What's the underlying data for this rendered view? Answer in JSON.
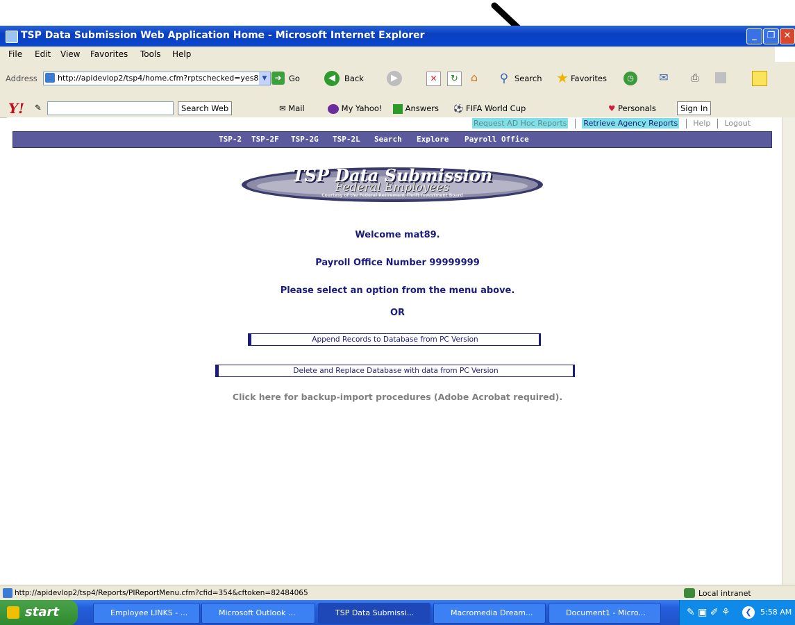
{
  "window": {
    "title": "TSP Data Submission Web Application Home - Microsoft Internet Explorer"
  },
  "menubar": {
    "items": [
      "File",
      "Edit",
      "View",
      "Favorites",
      "Tools",
      "Help"
    ]
  },
  "addressbar": {
    "label": "Address",
    "url": "http://apidevlop2/tsp4/home.cfm?rptschecked=yes8",
    "go": "Go",
    "back": "Back",
    "search": "Search",
    "favorites": "Favorites"
  },
  "yahoo_toolbar": {
    "search_web": "Search Web",
    "mail": "Mail",
    "my_yahoo": "My Yahoo!",
    "answers": "Answers",
    "fifa": "FIFA World Cup",
    "personals": "Personals",
    "sign_in": "Sign In"
  },
  "top_nav": {
    "request_adhoc": "Request AD Hoc Reports",
    "retrieve_agency": "Retrieve Agency Reports",
    "help": "Help",
    "logout": "Logout"
  },
  "main_nav": [
    "TSP-2",
    "TSP-2F",
    "TSP-2G",
    "TSP-2L",
    "Search",
    "Explore",
    "Payroll Office"
  ],
  "logo": {
    "line1": "TSP Data Submission",
    "line2": "Federal Employees",
    "line3": "Courtesy of the Federal Retirement Thrift Investment Board"
  },
  "main": {
    "welcome": "Welcome mat89.",
    "payroll": "Payroll Office Number 99999999",
    "instruction": "Please select an option from the menu above.",
    "or": "OR",
    "append_button": "Append Records to Database from PC Version",
    "replace_button": "Delete and Replace Database with data from PC Version",
    "backup_link": "Click here for backup-import procedures (Adobe Acrobat required)."
  },
  "statusbar": {
    "url": "http://apidevlop2/tsp4/Reports/PIReportMenu.cfm?cfid=354&cftoken=82484065",
    "zone": "Local intranet"
  },
  "taskbar": {
    "start": "start",
    "tasks": [
      "Employee LINKS - ...",
      "Microsoft Outlook ...",
      "TSP Data Submissi...",
      "Macromedia Dream...",
      "Document1 - Micro..."
    ],
    "clock": "5:58 AM"
  },
  "colors": {
    "nav_bar": "#5a5a9c",
    "text_navy": "#1c1c7a",
    "highlight_cyan": "#7fe0e8",
    "xp_blue": "#0a3fc0"
  }
}
